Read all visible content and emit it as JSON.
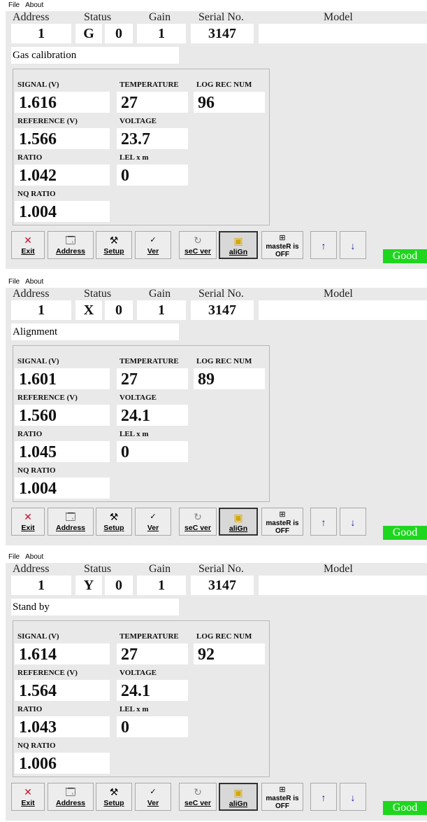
{
  "menu": [
    "File",
    "About"
  ],
  "headers": {
    "address": "Address",
    "status": "Status",
    "gain": "Gain",
    "serial": "Serial No.",
    "model": "Model"
  },
  "labels": {
    "signal": "SIGNAL (V)",
    "temperature": "TEMPERATURE",
    "log": "LOG REC NUM",
    "reference": "REFERENCE (V)",
    "voltage": "VOLTAGE",
    "ratio": "RATIO",
    "lel": "LEL x m",
    "nq": "NQ RATIO"
  },
  "toolbar": {
    "exit": "Exit",
    "address": "Address",
    "setup": "Setup",
    "ver": "Ver",
    "secver": "seC ver",
    "align": "aliGn",
    "master_line1": "masteR is",
    "master_line2": "OFF"
  },
  "indicator": "Good",
  "panels": [
    {
      "address": "1",
      "status_code": "G",
      "status_num": "0",
      "gain": "1",
      "serial": "3147",
      "model": "",
      "mode": "Gas calibration",
      "signal": "1.616",
      "temperature": "27",
      "log": "96",
      "reference": "1.566",
      "voltage": "23.7",
      "ratio": "1.042",
      "lel": "0",
      "nq": "1.004"
    },
    {
      "address": "1",
      "status_code": "X",
      "status_num": "0",
      "gain": "1",
      "serial": "3147",
      "model": "",
      "mode": "Alignment",
      "signal": "1.601",
      "temperature": "27",
      "log": "89",
      "reference": "1.560",
      "voltage": "24.1",
      "ratio": "1.045",
      "lel": "0",
      "nq": "1.004"
    },
    {
      "address": "1",
      "status_code": "Y",
      "status_num": "0",
      "gain": "1",
      "serial": "3147",
      "model": "",
      "mode": "Stand by",
      "signal": "1.614",
      "temperature": "27",
      "log": "92",
      "reference": "1.564",
      "voltage": "24.1",
      "ratio": "1.043",
      "lel": "0",
      "nq": "1.006"
    }
  ]
}
